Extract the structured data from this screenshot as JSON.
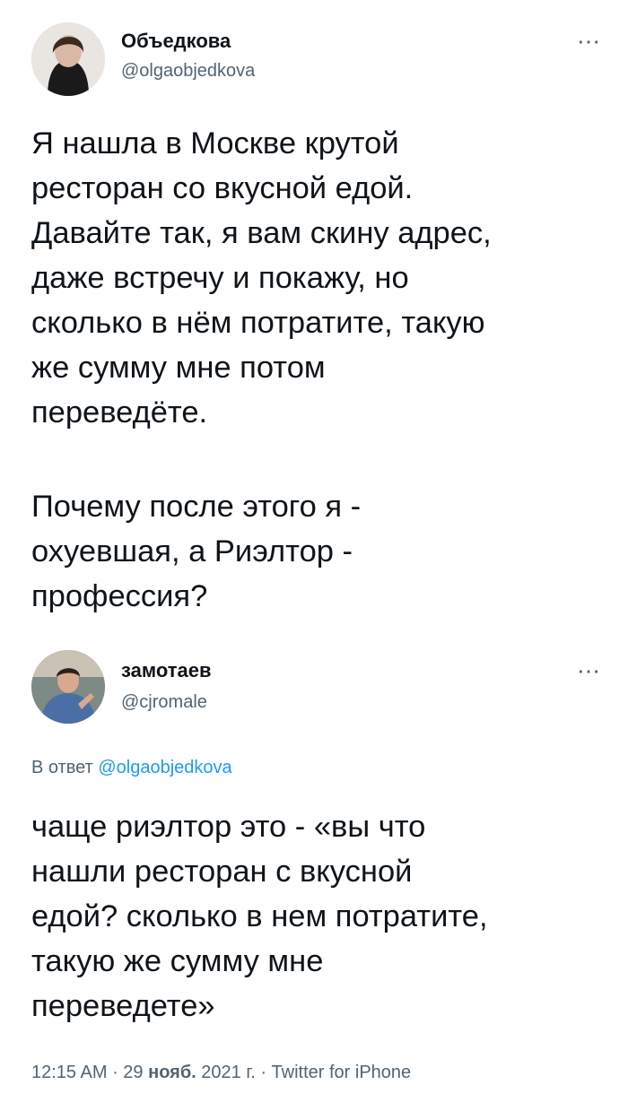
{
  "tweet1": {
    "name": "Объедкова",
    "handle": "@olgaobjedkova",
    "more_icon": "⋯",
    "text_p1": "Я нашла в Москве крутой\nресторан со вкусной едой.\nДавайте так, я вам скину адрес,\nдаже встречу и покажу, но\nсколько в нём потратите, такую\nже сумму мне потом\nпереведёте.",
    "text_p2": "Почему после этого я -\nохуевшая, а Риэлтор -\nпрофессия?"
  },
  "tweet2": {
    "name": "замотаев",
    "handle": "@cjromale",
    "more_icon": "⋯",
    "reply_prefix": "В ответ",
    "reply_handle": "@olgaobjedkova",
    "text": "чаще риэлтор это - «вы что\nнашли ресторан с вкусной\nедой? сколько в нем потратите,\nтакую же сумму мне\nпереведете»"
  },
  "meta": {
    "time": "12:15 AM",
    "sep1": " · ",
    "date_day": "29",
    "date_month": "нояб.",
    "date_year": "2021 г.",
    "sep2": " · ",
    "source": "Twitter for iPhone"
  }
}
